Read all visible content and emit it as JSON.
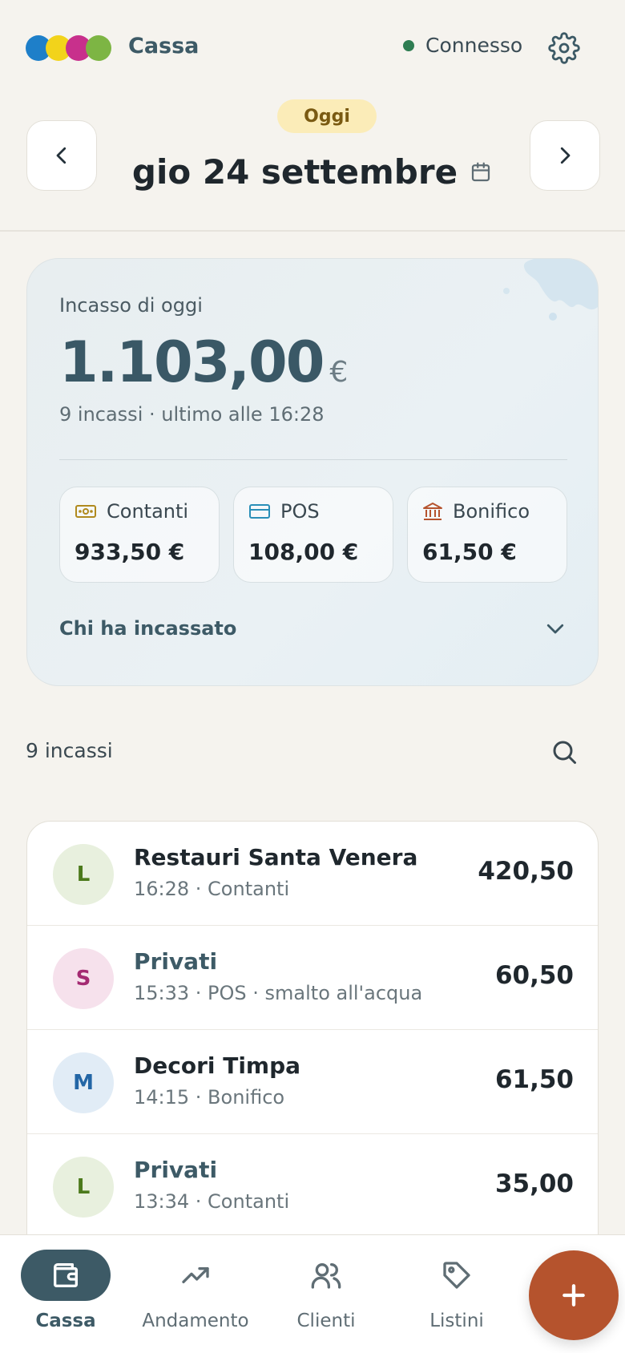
{
  "colors": {
    "accent": "#3d5a66",
    "logo_blue": "#1e7fc9",
    "logo_yellow": "#f2d31b",
    "logo_magenta": "#c8308c",
    "logo_green": "#7db544",
    "status_green": "#2e7d52",
    "today_pill_bg": "#fbecb8",
    "today_pill_text": "#7a5a12",
    "fab": "#b5532d",
    "cash_icon": "#b08a1e",
    "pos_icon": "#2a8fb8",
    "bank_icon": "#b5532d"
  },
  "header": {
    "app_title": "Cassa",
    "status": "Connesso",
    "settings_icon": "gear-icon"
  },
  "date_nav": {
    "today_label": "Oggi",
    "date": "gio 24 settembre",
    "prev_icon": "chevron-left-icon",
    "next_icon": "chevron-right-icon",
    "calendar_icon": "calendar-icon"
  },
  "summary": {
    "label": "Incasso di oggi",
    "total": "1.103,00",
    "currency": "€",
    "subtitle": "9 incassi · ultimo alle 16:28",
    "methods": [
      {
        "label": "Contanti",
        "amount": "933,50 €",
        "icon": "cash-icon"
      },
      {
        "label": "POS",
        "amount": "108,00 €",
        "icon": "card-icon"
      },
      {
        "label": "Bonifico",
        "amount": "61,50 €",
        "icon": "bank-icon"
      }
    ],
    "who_label": "Chi ha incassato"
  },
  "list": {
    "count_label": "9 incassi",
    "search_icon": "search-icon",
    "items": [
      {
        "initial": "L",
        "name": "Restauri Santa Venera",
        "sub": "16:28 · Contanti",
        "amount": "420,50",
        "avatar_bg": "#e8f0de",
        "avatar_fg": "#4c7a1c",
        "name_color": "#1f272d"
      },
      {
        "initial": "S",
        "name": "Privati",
        "sub": "15:33 · POS · smalto all'acqua",
        "amount": "60,50",
        "avatar_bg": "#f6e1ec",
        "avatar_fg": "#a42a72",
        "name_color": "#3d5a66"
      },
      {
        "initial": "M",
        "name": "Decori Timpa",
        "sub": "14:15 · Bonifico",
        "amount": "61,50",
        "avatar_bg": "#e1ecf6",
        "avatar_fg": "#2366a6",
        "name_color": "#1f272d"
      },
      {
        "initial": "L",
        "name": "Privati",
        "sub": "13:34 · Contanti",
        "amount": "35,00",
        "avatar_bg": "#e8f0de",
        "avatar_fg": "#4c7a1c",
        "name_color": "#3d5a66"
      }
    ]
  },
  "bottom_nav": {
    "items": [
      {
        "label": "Cassa",
        "icon": "wallet-icon",
        "active": true
      },
      {
        "label": "Andamento",
        "icon": "trend-icon",
        "active": false
      },
      {
        "label": "Clienti",
        "icon": "users-icon",
        "active": false
      },
      {
        "label": "Listini",
        "icon": "tag-icon",
        "active": false
      }
    ],
    "fab_icon": "plus-icon"
  }
}
